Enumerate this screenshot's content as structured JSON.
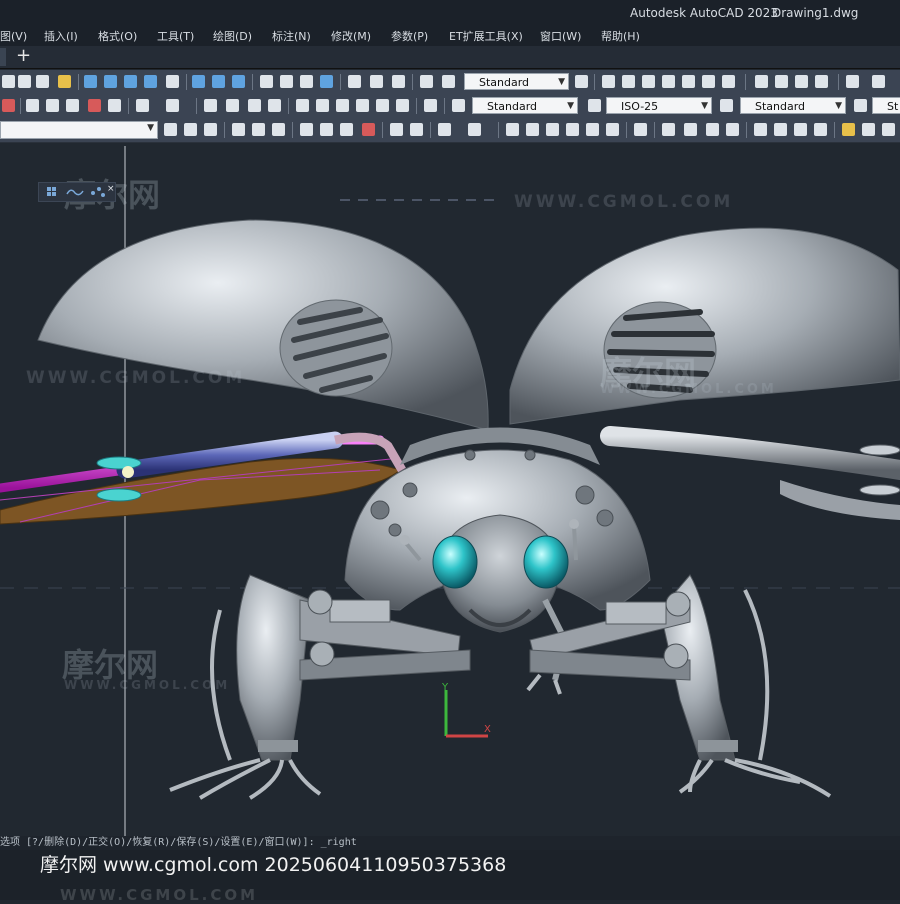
{
  "title": {
    "app": "Autodesk AutoCAD 2023",
    "file": "Drawing1.dwg"
  },
  "menu": [
    "图(V)",
    "插入(I)",
    "格式(O)",
    "工具(T)",
    "绘图(D)",
    "标注(N)",
    "修改(M)",
    "参数(P)",
    "ET扩展工具(X)",
    "窗口(W)",
    "帮助(H)"
  ],
  "toolbar": {
    "plus_label": "+",
    "text_style": "Standard",
    "text_style_2": "Standard",
    "dim_style": "ISO-25",
    "table_style": "Standard",
    "multileader_style": "St"
  },
  "viewport": {
    "watermark_en": "WWW.CGMOL.COM",
    "watermark_cn": "摩尔网"
  },
  "command_line": "选项 [?/删除(D)/正交(O)/恢复(R)/保存(S)/设置(E)/窗口(W)]: _right",
  "footer": {
    "caption": "摩尔网 www.cgmol.com 20250604110950375368",
    "ghost": "WWW.CGMOL.COM"
  }
}
